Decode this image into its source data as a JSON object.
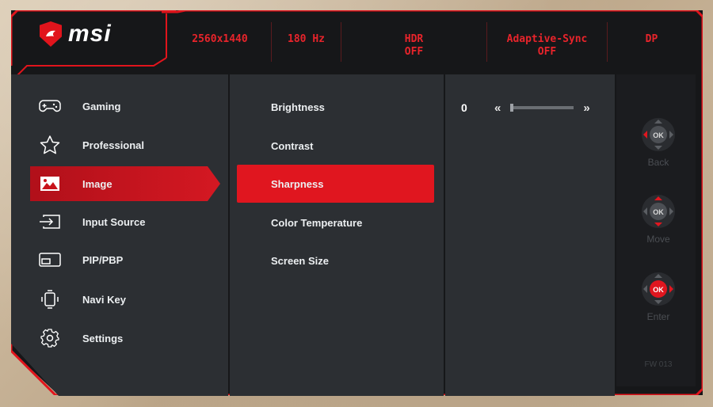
{
  "brand": {
    "name": "msi",
    "accent": "#e0161f"
  },
  "status_bar": {
    "resolution": "2560x1440",
    "refresh": "180 Hz",
    "hdr_label": "HDR",
    "hdr_value": "OFF",
    "adaptive_label": "Adaptive-Sync",
    "adaptive_value": "OFF",
    "input": "DP"
  },
  "main_menu": [
    {
      "label": "Gaming",
      "icon": "gamepad-icon"
    },
    {
      "label": "Professional",
      "icon": "star-icon"
    },
    {
      "label": "Image",
      "icon": "image-icon",
      "active": true
    },
    {
      "label": "Input Source",
      "icon": "input-icon"
    },
    {
      "label": "PIP/PBP",
      "icon": "pip-icon"
    },
    {
      "label": "Navi Key",
      "icon": "navi-key-icon"
    },
    {
      "label": "Settings",
      "icon": "gear-icon"
    }
  ],
  "sub_menu": [
    {
      "label": "Brightness"
    },
    {
      "label": "Contrast"
    },
    {
      "label": "Sharpness",
      "active": true
    },
    {
      "label": "Color Temperature"
    },
    {
      "label": "Screen Size"
    }
  ],
  "value_panel": {
    "value": "0",
    "level": 0,
    "left_arrow": "«",
    "right_arrow": "»"
  },
  "nav_keys": [
    {
      "label": "Back",
      "center": "OK"
    },
    {
      "label": "Move",
      "center": "OK"
    },
    {
      "label": "Enter",
      "center": "OK"
    }
  ],
  "firmware": "FW 013"
}
